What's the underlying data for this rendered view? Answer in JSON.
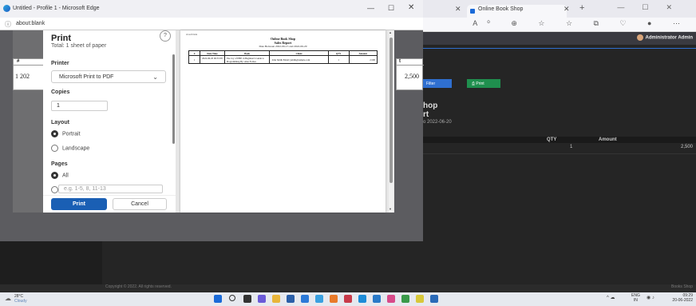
{
  "background_browser": {
    "tab_title": "Online Book Shop",
    "admin_label": "Administrator Admin",
    "filter_label": "Filter",
    "print_label": "Print",
    "report_title_line1": "hop",
    "report_title_line2": "rt",
    "report_date": "o 2022-06-20",
    "table_headers": {
      "qty": "QTY",
      "amount": "Amount"
    },
    "table_row": {
      "qty": "1",
      "amount": "2,500"
    },
    "footer_left": "Copyright © 2022. All rights reserved.",
    "footer_right": "Books Shop"
  },
  "edge_window": {
    "title": "Untitled - Profile 1 - Microsoft Edge",
    "minimize_glyph": "—",
    "maximize_glyph": "☐",
    "close_glyph": "✕",
    "url": "about:blank",
    "bg_table_left_header": "#",
    "bg_table_left_row": "1  202",
    "bg_table_right_header": "t",
    "bg_table_right_row": "2,500"
  },
  "print_dialog": {
    "heading": "Print",
    "subtitle": "Total: 1 sheet of paper",
    "help_glyph": "?",
    "printer_label": "Printer",
    "printer_value": "Microsoft Print to PDF",
    "copies_label": "Copies",
    "copies_value": "1",
    "layout_label": "Layout",
    "layout_options": [
      "Portrait",
      "Landscape"
    ],
    "layout_selected": "Portrait",
    "pages_label": "Pages",
    "pages_options": [
      "All"
    ],
    "pages_range_placeholder": "e.g. 1-5, 8, 11-13",
    "print_button": "Print",
    "cancel_button": "Cancel"
  },
  "preview": {
    "header_left": "about:blank",
    "title": "Online Book Shop",
    "subtitle": "Sales Report",
    "date_range": "Date Between 2022-06-15 and 2022-06-20",
    "columns": [
      "#",
      "Date Time",
      "Book",
      "Client",
      "QTY",
      "Amount"
    ],
    "rows": [
      {
        "num": "1",
        "datetime": "2022-06-20 06:53:38",
        "book": "The Joy of PHP: A Beginner's Guide to Programming By: Alan Forbes",
        "client": "John Smith Email: jsmith@sample.com",
        "qty": "1",
        "amount": "2,500"
      }
    ]
  },
  "taskbar": {
    "temperature": "28°C",
    "condition": "Cloudy",
    "lang_line1": "ENG",
    "lang_line2": "IN",
    "time": "09:29",
    "date": "20-06-2022"
  },
  "colors": {
    "accent_blue": "#1a5fb4",
    "print_green": "#1f8f4e",
    "dark_bg": "#252525"
  }
}
